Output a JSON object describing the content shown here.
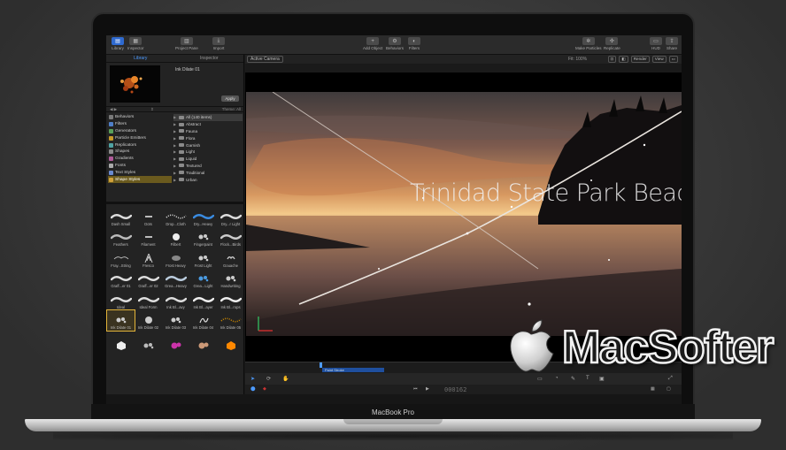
{
  "device": {
    "label": "MacBook Pro"
  },
  "toolbar": {
    "library": "Library",
    "inspector": "Inspector",
    "project_pane": "Project Pane",
    "import": "Import",
    "add_object": "Add Object",
    "behaviors": "Behaviors",
    "filters": "Filters",
    "make_particles": "Make Particles",
    "replicate": "Replicate",
    "hud": "HUD",
    "share": "Share"
  },
  "panel": {
    "tab_library": "Library",
    "tab_inspector": "Inspector",
    "preview_title": "Ink Dilate 01",
    "apply": "Apply",
    "theme_label": "Theme: All",
    "categories": [
      {
        "label": "Behaviors",
        "color": "#7a7a7a"
      },
      {
        "label": "Filters",
        "color": "#4f7fc8"
      },
      {
        "label": "Generators",
        "color": "#5aa05a"
      },
      {
        "label": "Particle Emitters",
        "color": "#c89a2a"
      },
      {
        "label": "Replicators",
        "color": "#4fa3a3"
      },
      {
        "label": "Shapes",
        "color": "#8a8a8a"
      },
      {
        "label": "Gradients",
        "color": "#b05a9a"
      },
      {
        "label": "Fonts",
        "color": "#aaaaaa"
      },
      {
        "label": "Text Styles",
        "color": "#6a8ad0"
      },
      {
        "label": "Shape Styles",
        "color": "#d0a03a"
      }
    ],
    "subcategories": [
      "All (140 items)",
      "Abstract",
      "Fauna",
      "Flora",
      "Garnish",
      "Light",
      "Liquid",
      "Textured",
      "Traditional",
      "Urban"
    ],
    "styles": [
      "Dash Small",
      "Dots",
      "Drop...Cloth",
      "Dry...Heavy",
      "Dry...r Light",
      "Feathers",
      "Filament",
      "Filbert",
      "Fingerpaint",
      "Flock...Birds",
      "Fray...String",
      "Fresco",
      "Frost Heavy",
      "Frost Light",
      "Gouache",
      "Graff...er 01",
      "Graff...er 02",
      "Grea...Heavy",
      "Grea...Light",
      "Handwriting",
      "Ideal",
      "Ideal Form",
      "Ink Bl...avy",
      "Ink Bl...ayer",
      "Ink Bl...rops",
      "Ink Dilate 01",
      "Ink Dilate 02",
      "Ink Dilate 03",
      "Ink Dilate 04",
      "Ink Dilate 05",
      "",
      "",
      "",
      "",
      ""
    ]
  },
  "canvas": {
    "active_camera": "Active Camera",
    "fit": "Fit: 100%",
    "render": "Render",
    "view": "View",
    "title_text": "Trinidad State Park Beach",
    "clip_name": "Paint Stroke",
    "timecode": "000162"
  },
  "watermark": {
    "text": "MacSofter"
  },
  "colors": {
    "accent": "#2f6ad0",
    "selection": "#e3b43a"
  }
}
